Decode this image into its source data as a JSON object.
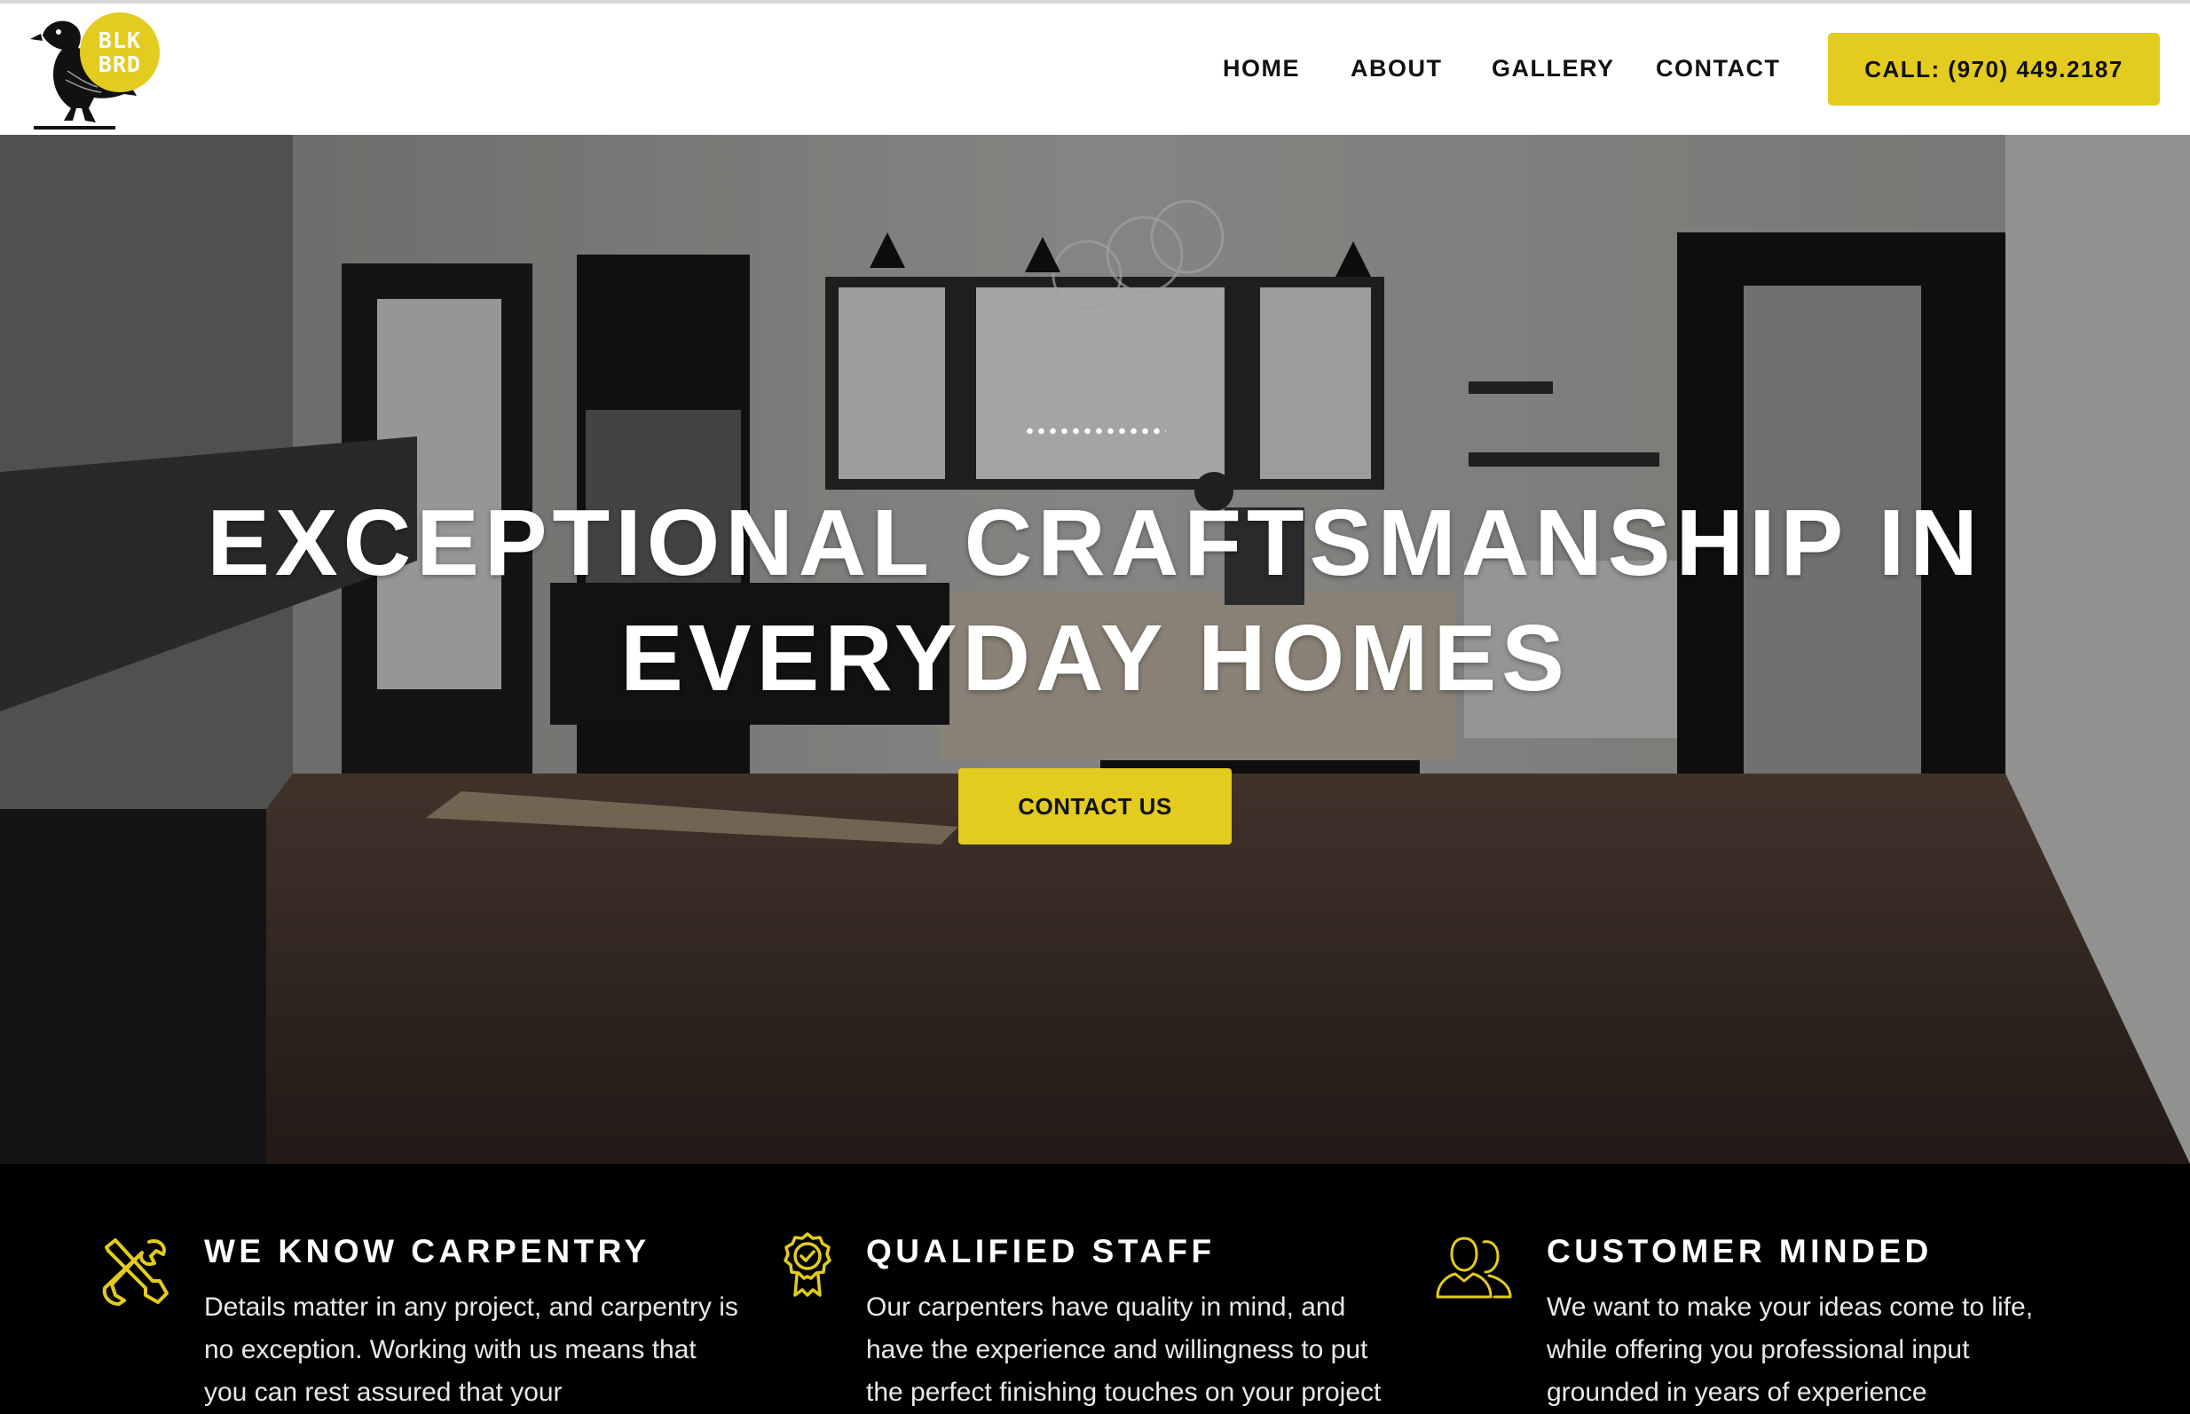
{
  "header": {
    "logo": {
      "line1": "BLK",
      "line2": "BRD"
    },
    "nav": [
      {
        "label": "HOME"
      },
      {
        "label": "ABOUT"
      },
      {
        "label": "GALLERY"
      },
      {
        "label": "CONTACT"
      }
    ],
    "call_button": "CALL: (970) 449.2187"
  },
  "hero": {
    "title_line1": "EXCEPTIONAL CRAFTSMANSHIP IN",
    "title_line2": "EVERYDAY HOMES",
    "cta": "CONTACT US"
  },
  "features": [
    {
      "icon": "tools-icon",
      "title": "WE KNOW CARPENTRY",
      "text": "Details matter in any project, and carpentry is no exception. Working with us means that you can rest assured that your"
    },
    {
      "icon": "award-badge-icon",
      "title": "QUALIFIED STAFF",
      "text": "Our carpenters have quality in mind, and have the experience and willingness to put the perfect finishing touches on your project"
    },
    {
      "icon": "users-icon",
      "title": "CUSTOMER MINDED",
      "text": "We want to make your ideas come to life, while offering you professional input grounded in years of experience"
    }
  ],
  "colors": {
    "accent": "#e3cb1f",
    "header_bg": "#ffffff",
    "features_bg": "#000000"
  }
}
